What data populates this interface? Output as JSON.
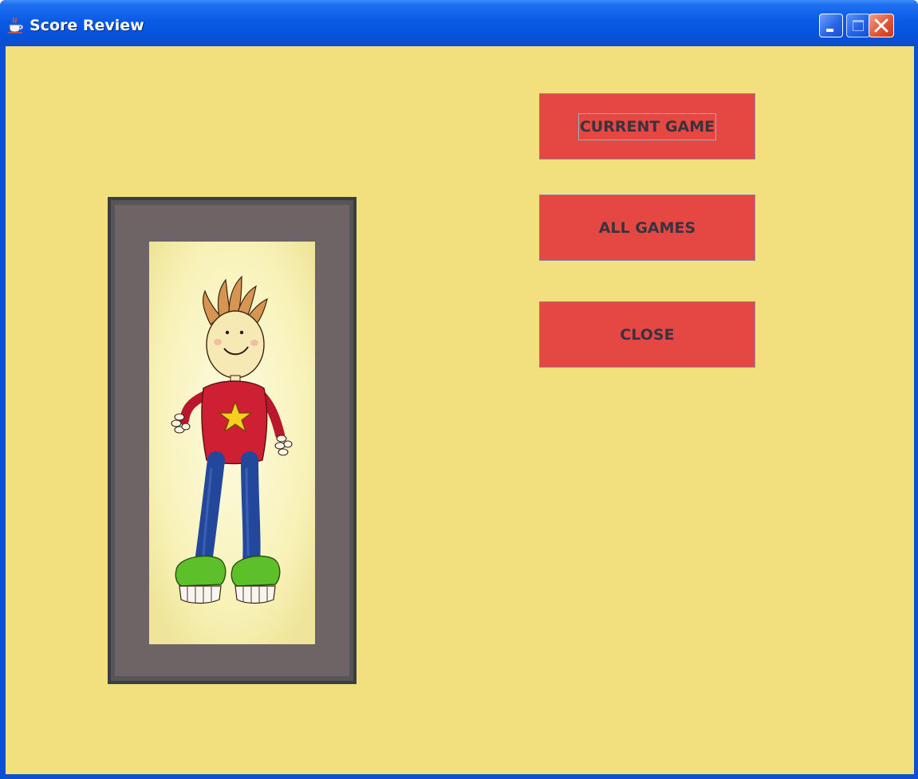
{
  "window": {
    "title": "Score Review",
    "controls": {
      "minimize": "minimize-icon",
      "maximize": "maximize-icon",
      "close": "close-icon"
    }
  },
  "buttons": {
    "current_game": "CURRENT GAME",
    "all_games": "ALL GAMES",
    "close": "CLOSE"
  },
  "colors": {
    "background": "#f2e07f",
    "button": "#e54843",
    "button_text": "#3b3240",
    "titlebar": "#0a5ae6"
  },
  "picture": {
    "icon": "framed-cartoon-boy-picture"
  }
}
